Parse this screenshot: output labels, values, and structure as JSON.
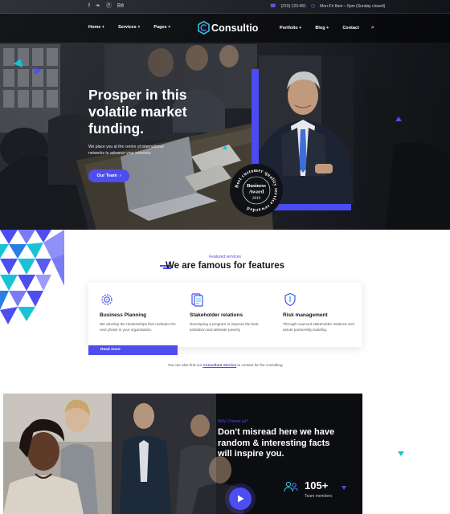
{
  "colors": {
    "accent": "#4d4df0",
    "cyan": "#19c3d6",
    "dark": "#17181c"
  },
  "topbar": {
    "social": [
      {
        "icon": "facebook-icon",
        "glyph": "f"
      },
      {
        "icon": "twitter-icon",
        "glyph": "❧"
      },
      {
        "icon": "pinterest-icon",
        "glyph": "Ⓟ"
      },
      {
        "icon": "behance-icon",
        "glyph": "Bē"
      }
    ],
    "phone": "(210) 123-451",
    "hours": "Mon-Fri 8am – 6pm (Sunday closed)"
  },
  "nav": {
    "left": [
      "Home +",
      "Services +",
      "Pages +"
    ],
    "right": [
      "Portfolio +",
      "Blog +",
      "Contact"
    ],
    "logo": "Consultio"
  },
  "hero": {
    "title_lines": [
      "Prosper in this",
      "volatile market",
      "funding."
    ],
    "subtitle": "We place you at the centre of international networks to advance your interests.",
    "button": "Our Team",
    "badge_ring": "Best customer quality service rewarded",
    "badge_center_1": "Business",
    "badge_center_2": "Award",
    "badge_year": "2019"
  },
  "features": {
    "eyebrow": "Featured services",
    "title": "We are famous for features",
    "items": [
      {
        "icon": "gear-icon",
        "title": "Business Planning",
        "desc": "We develop the relationships that underpin the next phase in your organisation."
      },
      {
        "icon": "document-icon",
        "title": "Stakeholder relations",
        "desc": "Developing a program to improve the best sanitation and alleviate poverty"
      },
      {
        "icon": "shield-icon",
        "title": "Risk management",
        "desc": "Through nuanced stakeholder relations and astute partnership building."
      }
    ],
    "read_more": "Read more",
    "note_before": "You can also find our",
    "note_link": "Consultant Service",
    "note_after": "to contact for the consulting"
  },
  "why": {
    "eyebrow": "Why Choose us?",
    "title": "Don't misread here we have random & interesting facts will inspire you.",
    "stat_value": "105+",
    "stat_label": "Team members"
  }
}
